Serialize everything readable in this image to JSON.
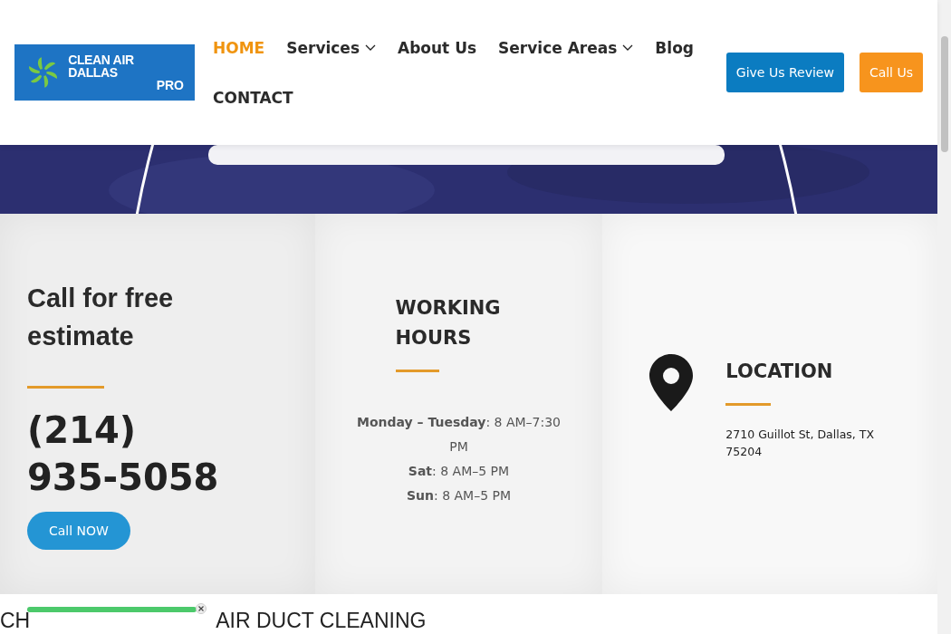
{
  "header": {
    "logo": {
      "line1": "CLEAN AIR DALLAS",
      "line2": "PRO"
    },
    "nav": [
      {
        "label": "HOME",
        "selected": true,
        "dropdown": false
      },
      {
        "label": "Services",
        "selected": false,
        "dropdown": true
      },
      {
        "label": "About Us",
        "selected": false,
        "dropdown": false
      },
      {
        "label": "Service Areas",
        "selected": false,
        "dropdown": true
      },
      {
        "label": "Blog",
        "selected": false,
        "dropdown": false
      },
      {
        "label": "CONTACT",
        "selected": false,
        "dropdown": false
      }
    ],
    "buttons": [
      {
        "label": "Give Us Review",
        "color": "#0b7cc1"
      },
      {
        "label": "Call Us",
        "color": "#f7941d"
      }
    ]
  },
  "cards": [
    {
      "kind": "call",
      "title": "Call for free estimate",
      "phone": "(214) 935-5058",
      "button": "Call NOW"
    },
    {
      "kind": "hours",
      "title": "WORKING HOURS",
      "lines": [
        "**Monday – Tuesday**: 8 AM–7:30 PM",
        "**Sat**: 8 AM–5 PM",
        "**Sun**: 8 AM–5 PM"
      ]
    },
    {
      "kind": "location",
      "title": "LOCATION",
      "address": "2710 Guillot St, Dallas, TX 75204"
    }
  ],
  "footer_strip": {
    "left": "CH",
    "right": "AIR DUCT CLEANING"
  }
}
